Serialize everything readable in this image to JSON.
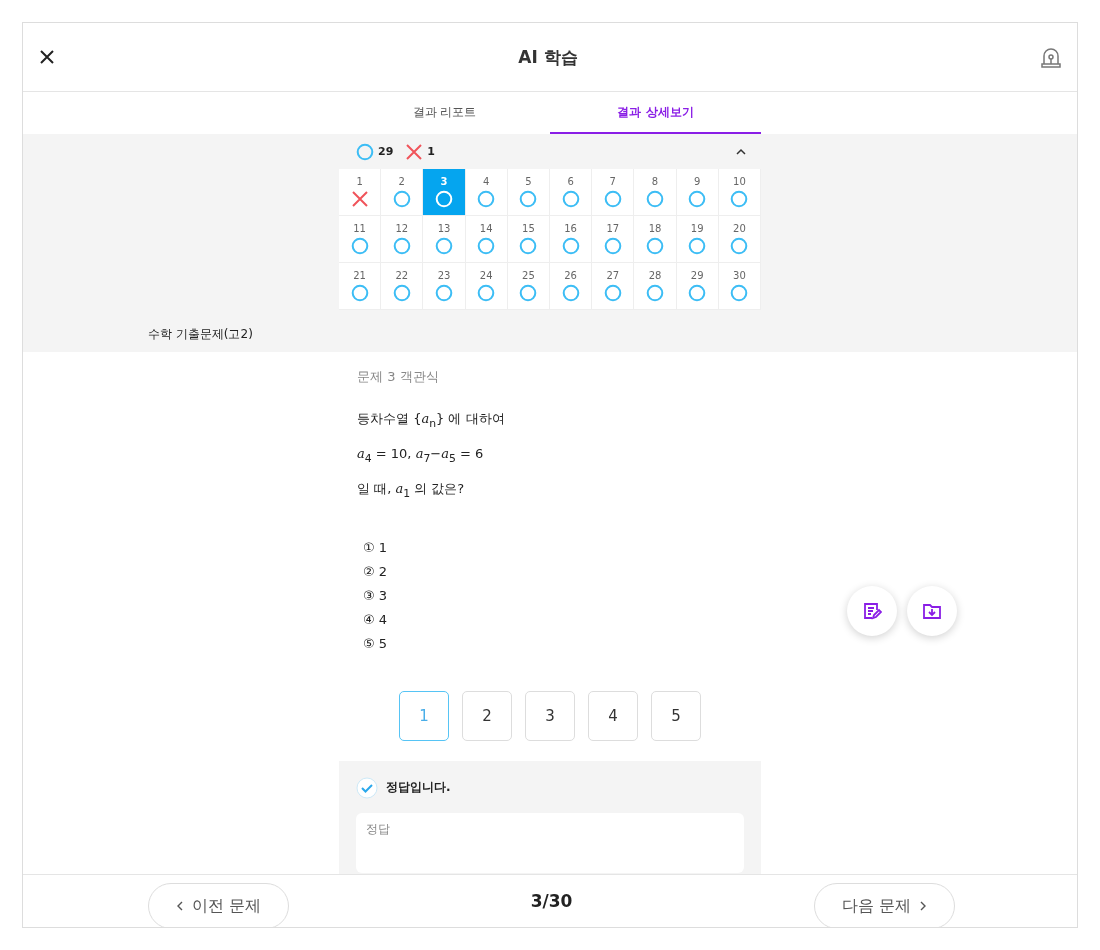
{
  "header": {
    "title": "AI 학습"
  },
  "tabs": [
    {
      "label": "결과 리포트",
      "selected": false
    },
    {
      "label": "결과 상세보기",
      "selected": true
    }
  ],
  "summary": {
    "correct_count": "29",
    "wrong_count": "1",
    "expanded": true
  },
  "grid": [
    {
      "number": "1",
      "kind": "wrong",
      "selected": false
    },
    {
      "number": "2",
      "kind": "correct",
      "selected": false
    },
    {
      "number": "3",
      "kind": "correct",
      "selected": true
    },
    {
      "number": "4",
      "kind": "correct",
      "selected": false
    },
    {
      "number": "5",
      "kind": "correct",
      "selected": false
    },
    {
      "number": "6",
      "kind": "correct",
      "selected": false
    },
    {
      "number": "7",
      "kind": "correct",
      "selected": false
    },
    {
      "number": "8",
      "kind": "correct",
      "selected": false
    },
    {
      "number": "9",
      "kind": "correct",
      "selected": false
    },
    {
      "number": "10",
      "kind": "correct",
      "selected": false
    },
    {
      "number": "11",
      "kind": "correct",
      "selected": false
    },
    {
      "number": "12",
      "kind": "correct",
      "selected": false
    },
    {
      "number": "13",
      "kind": "correct",
      "selected": false
    },
    {
      "number": "14",
      "kind": "correct",
      "selected": false
    },
    {
      "number": "15",
      "kind": "correct",
      "selected": false
    },
    {
      "number": "16",
      "kind": "correct",
      "selected": false
    },
    {
      "number": "17",
      "kind": "correct",
      "selected": false
    },
    {
      "number": "18",
      "kind": "correct",
      "selected": false
    },
    {
      "number": "19",
      "kind": "correct",
      "selected": false
    },
    {
      "number": "20",
      "kind": "correct",
      "selected": false
    },
    {
      "number": "21",
      "kind": "correct",
      "selected": false
    },
    {
      "number": "22",
      "kind": "correct",
      "selected": false
    },
    {
      "number": "23",
      "kind": "correct",
      "selected": false
    },
    {
      "number": "24",
      "kind": "correct",
      "selected": false
    },
    {
      "number": "25",
      "kind": "correct",
      "selected": false
    },
    {
      "number": "26",
      "kind": "correct",
      "selected": false
    },
    {
      "number": "27",
      "kind": "correct",
      "selected": false
    },
    {
      "number": "28",
      "kind": "correct",
      "selected": false
    },
    {
      "number": "29",
      "kind": "correct",
      "selected": false
    },
    {
      "number": "30",
      "kind": "correct",
      "selected": false
    }
  ],
  "subject": "수학 기출문제(고2)",
  "question": {
    "label": "문제 3 객관식",
    "lines": [
      "등차수열 {*a*$_{n}$} 에 대하여",
      "*a*$_{4}$ = 10, *a*$_{7}$−*a*$_{5}$ = 6",
      "일 때, *a*$_{1}$ 의 값은?"
    ],
    "options": [
      "① 1",
      "② 2",
      "③ 3",
      "④ 4",
      "⑤ 5"
    ]
  },
  "answer_buttons": [
    {
      "label": "1",
      "selected": true
    },
    {
      "label": "2",
      "selected": false
    },
    {
      "label": "3",
      "selected": false
    },
    {
      "label": "4",
      "selected": false
    },
    {
      "label": "5",
      "selected": false
    }
  ],
  "result": {
    "message": "정답입니다.",
    "answer_label": "정답"
  },
  "footer": {
    "prev": "이전 문제",
    "progress": "3/30",
    "next": "다음 문제"
  }
}
